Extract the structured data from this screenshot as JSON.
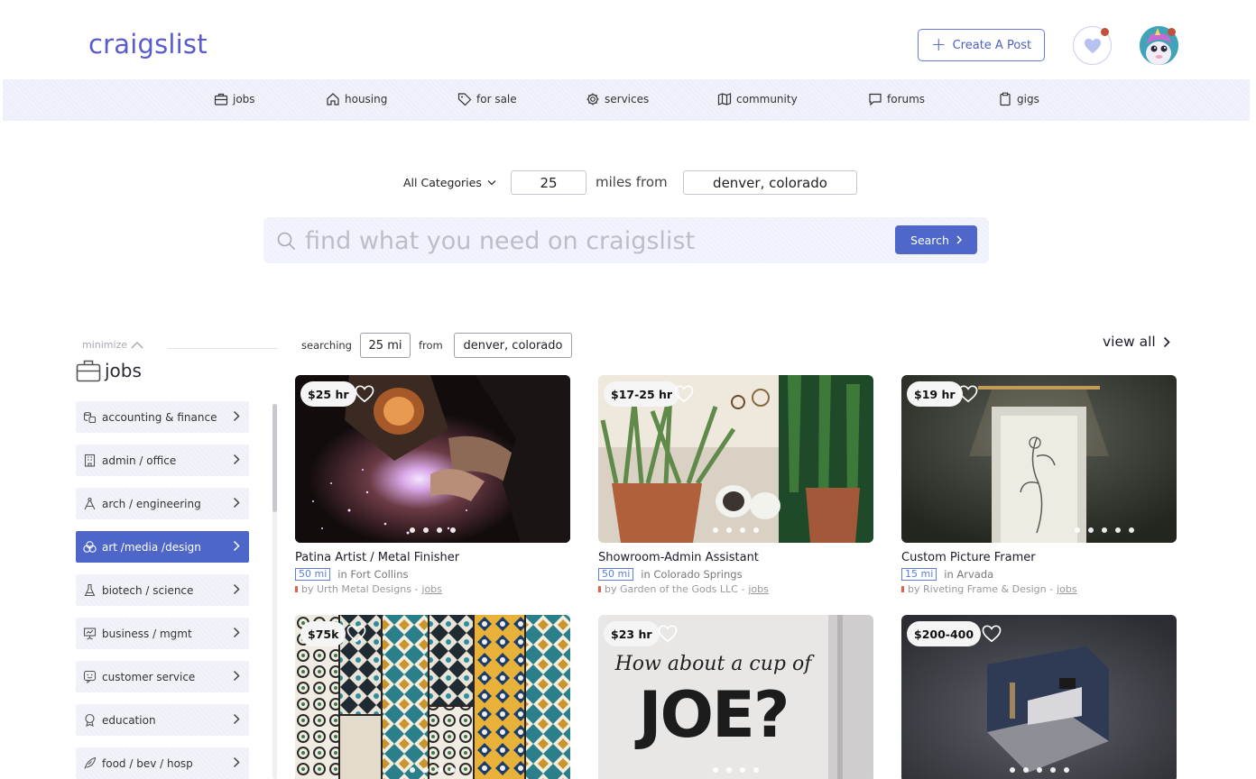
{
  "header": {
    "logo": "craigslist",
    "create_post": "Create A Post",
    "favorites_icon": "heart-icon",
    "avatar_icon": "unicorn-avatar"
  },
  "nav": [
    {
      "label": "jobs",
      "icon": "briefcase-icon"
    },
    {
      "label": "housing",
      "icon": "house-icon"
    },
    {
      "label": "for sale",
      "icon": "tag-icon"
    },
    {
      "label": "services",
      "icon": "gear-icon"
    },
    {
      "label": "community",
      "icon": "map-icon"
    },
    {
      "label": "forums",
      "icon": "chat-icon"
    },
    {
      "label": "gigs",
      "icon": "clipboard-icon"
    }
  ],
  "search": {
    "category": "All Categories",
    "miles": "25",
    "miles_from": "miles from",
    "location": "denver, colorado",
    "placeholder": "find what you need on craigslist",
    "button": "Search"
  },
  "sidebar": {
    "minimize": "minimize",
    "title": "jobs",
    "items": [
      {
        "label": "accounting & finance",
        "icon": "coins-icon",
        "active": false
      },
      {
        "label": "admin / office",
        "icon": "building-icon",
        "active": false
      },
      {
        "label": "arch / engineering",
        "icon": "compass-icon",
        "active": false
      },
      {
        "label": "art /media /design",
        "icon": "palette-icon",
        "active": true
      },
      {
        "label": "biotech / science",
        "icon": "flask-icon",
        "active": false
      },
      {
        "label": "business / mgmt",
        "icon": "presentation-icon",
        "active": false
      },
      {
        "label": "customer service",
        "icon": "support-icon",
        "active": false
      },
      {
        "label": "education",
        "icon": "graduation-icon",
        "active": false
      },
      {
        "label": "food / bev / hosp",
        "icon": "leaf-icon",
        "active": false
      }
    ]
  },
  "results": {
    "searching_label": "searching",
    "radius": "25 mi",
    "from_label": "from",
    "location": "denver, colorado",
    "view_all": "view all"
  },
  "listings": [
    {
      "price": "$25 hr",
      "title": "Patina Artist / Metal Finisher",
      "distance": "50 mi",
      "location": "in Fort Collins",
      "by": "by Urth Metal Designs -",
      "category": "jobs",
      "image": "welding-photo"
    },
    {
      "price": "$17-25 hr",
      "title": "Showroom-Admin Assistant",
      "distance": "50 mi",
      "location": "in Colorado Springs",
      "by": "by Garden of the Gods LLC -",
      "category": "jobs",
      "image": "plants-photo"
    },
    {
      "price": "$19 hr",
      "title": "Custom Picture Framer",
      "distance": "15 mi",
      "location": "in Arvada",
      "by": "by Riveting Frame & Design -",
      "category": "jobs",
      "image": "framed-art-photo"
    },
    {
      "price": "$75k",
      "title": "",
      "distance": "",
      "location": "",
      "by": "",
      "category": "",
      "image": "tiles-photo"
    },
    {
      "price": "$23 hr",
      "title": "",
      "distance": "",
      "location": "",
      "by": "",
      "category": "",
      "image": "coffee-wall-photo",
      "image_text_line1": "How about a cup of",
      "image_text_line2": "JOE?"
    },
    {
      "price": "$200-400",
      "title": "",
      "distance": "",
      "location": "",
      "by": "",
      "category": "",
      "image": "3d-room-photo"
    }
  ],
  "colors": {
    "brand": "#5a5bd0",
    "accent": "#4e66c8",
    "nav_bg": "#eceef9",
    "notify": "#c2503a"
  }
}
